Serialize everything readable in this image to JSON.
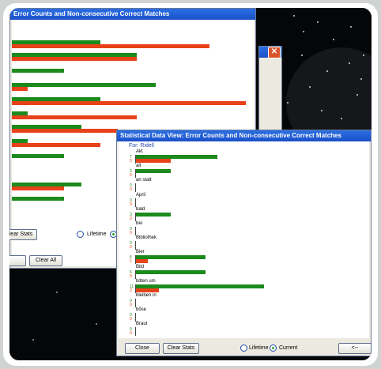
{
  "back_window": {
    "title": "Error Counts and Non-consecutive Correct Matches",
    "clear_stats_label": "Clear Stats",
    "lifetime_label": "Lifetime",
    "clear_all_label": "Clear All"
  },
  "front_window": {
    "title": "Statistical Data View: Error Counts and Non-consecutive Correct Matches",
    "subtitle": "For: Ridell",
    "close_label": "Close",
    "clear_stats_label": "Clear Stats",
    "lifetime_label": "Lifetime",
    "current_label": "Current",
    "back_label": "<--",
    "selected_mode": "Current",
    "words": [
      {
        "word": "Akt",
        "correct": 7,
        "errors": 3
      },
      {
        "word": "alt",
        "correct": 3,
        "errors": 0
      },
      {
        "word": "an statt",
        "correct": 0,
        "errors": 0
      },
      {
        "word": "April",
        "correct": 0,
        "errors": 0
      },
      {
        "word": "bald",
        "correct": 3,
        "errors": 0
      },
      {
        "word": "bei",
        "correct": 0,
        "errors": 0
      },
      {
        "word": "Bibliothek",
        "correct": 0,
        "errors": 0
      },
      {
        "word": "Bier",
        "correct": 6,
        "errors": 1
      },
      {
        "word": "Bild",
        "correct": 6,
        "errors": 0
      },
      {
        "word": "bitten um",
        "correct": 11,
        "errors": 2
      },
      {
        "word": "bleiben in",
        "correct": 0,
        "errors": 0
      },
      {
        "word": "böse",
        "correct": 0,
        "errors": 0
      },
      {
        "word": "Braut",
        "correct": 0,
        "errors": 0
      }
    ]
  },
  "colors": {
    "correct": "#1c8a1c",
    "errors": "#e8421a",
    "title_bar": "#2b6fe3",
    "close_icon": "#d9542d"
  }
}
